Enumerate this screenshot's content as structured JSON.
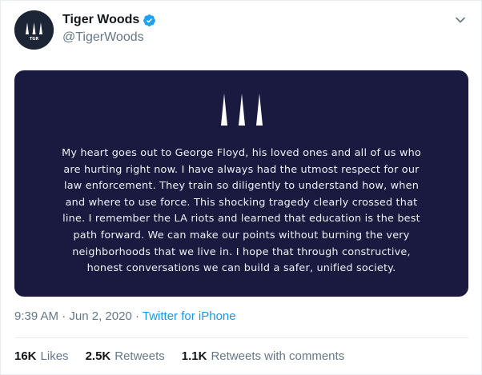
{
  "author": {
    "display_name": "Tiger Woods",
    "handle": "@TigerWoods",
    "verified": true,
    "avatar_monogram": "TGR",
    "avatar_icon": "tgr-logo-icon"
  },
  "media": {
    "background_color": "#1a1a40",
    "logo_icon": "tgr-three-peaks-icon",
    "statement": "My heart goes out to George Floyd, his loved ones and all of us who are hurting right now. I have always had the utmost respect for our law enforcement. They train so diligently to understand how, when and where to use force. This shocking tragedy clearly crossed that line. I remember the LA riots and learned that education is the best path forward. We can make our points without burning the very neighborhoods that we live in. I hope that through constructive, honest conversations we can build a safer, unified society."
  },
  "meta": {
    "time": "9:39 AM",
    "separator1": "·",
    "date": "Jun 2, 2020",
    "separator2": "·",
    "source": "Twitter for iPhone"
  },
  "stats": {
    "likes_count": "16K",
    "likes_label": "Likes",
    "retweets_count": "2.5K",
    "retweets_label": "Retweets",
    "quotes_count": "1.1K",
    "quotes_label": "Retweets with comments"
  },
  "colors": {
    "accent": "#1b95e0",
    "verified_badge": "#1da1f2",
    "muted_text": "#657786",
    "card_bg": "#1a1a40"
  }
}
